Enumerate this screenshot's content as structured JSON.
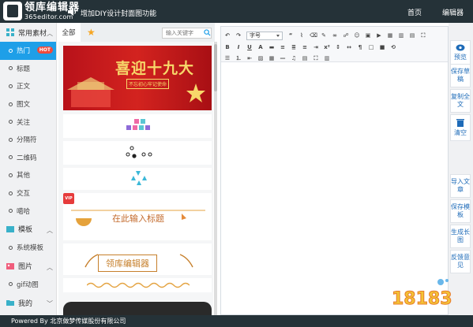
{
  "app": {
    "title": "领库编辑器",
    "subtitle": "365editor.com",
    "notice": "增加DIY设计封面图功能",
    "nav": [
      "首页",
      "编辑器"
    ]
  },
  "sidebar": {
    "sections": [
      {
        "label": "常用素材",
        "items": [
          "热门",
          "标题",
          "正文",
          "图文",
          "关注",
          "分隔符",
          "二维码",
          "其他",
          "交互",
          "噶哈"
        ]
      },
      {
        "label": "模板",
        "items": [
          "系统模板"
        ]
      },
      {
        "label": "图片",
        "items": [
          "gif动图"
        ]
      },
      {
        "label": "我的",
        "items": []
      }
    ],
    "hot_badge": "HOT"
  },
  "material_panel": {
    "tab_all": "全部",
    "search_placeholder": "输入关键字",
    "cards": [
      {
        "type": "banner",
        "title": "喜迎十九大",
        "sub": "不忘初心牢记使命"
      },
      {
        "type": "blocks"
      },
      {
        "type": "dots"
      },
      {
        "type": "triangles"
      },
      {
        "type": "fan-title",
        "vip": "VIP",
        "title": "在此输入标题"
      },
      {
        "type": "laurel-title",
        "title": "领库编辑器"
      },
      {
        "type": "wave"
      }
    ]
  },
  "editor": {
    "font_size_label": "字号"
  },
  "right_actions": {
    "top": [
      "预览",
      "保存草稿",
      "复制全文",
      "清空"
    ],
    "bottom": [
      "导入文章",
      "保存模板",
      "生成长图",
      "反馈意见"
    ]
  },
  "footer": {
    "text": "Powered By 北京做梦传媒股份有限公司"
  },
  "watermark": "18183",
  "colors": {
    "topbar": "#253238",
    "accent": "#1e9fe8",
    "hot": "#f04b3c",
    "banner": "#c81d1f"
  }
}
